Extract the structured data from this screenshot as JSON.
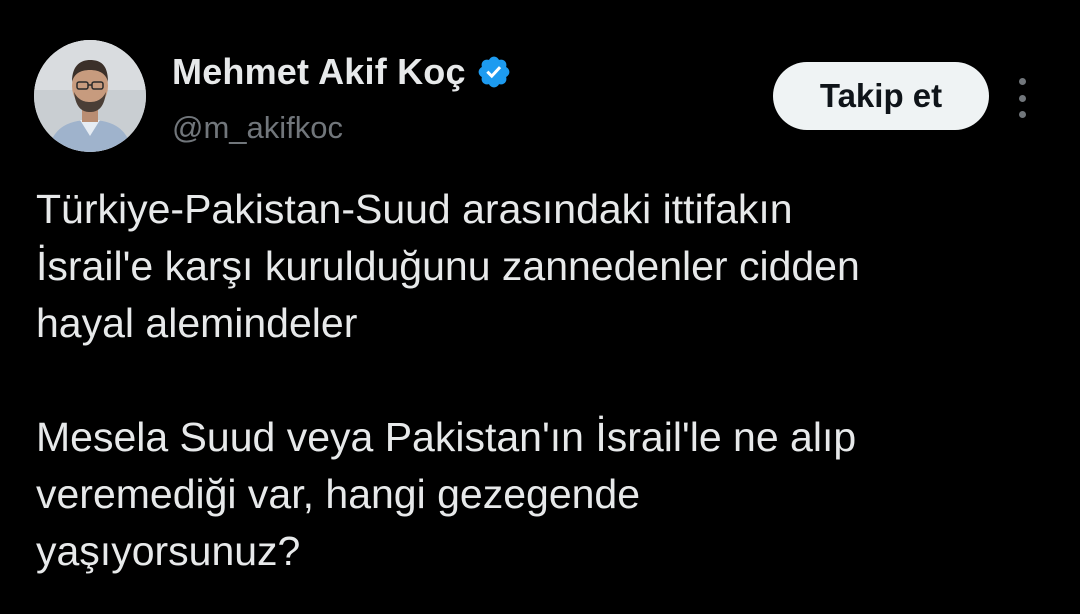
{
  "author": {
    "display_name": "Mehmet Akif Koç",
    "handle": "@m_akifkoc",
    "verified": true,
    "verified_color": "#1d9bf0",
    "avatar_icon": "profile-photo"
  },
  "actions": {
    "follow_label": "Takip et",
    "more_icon": "three-dots-vertical"
  },
  "tweet": {
    "paragraphs": [
      "Türkiye-Pakistan-Suud arasındaki ittifakın\nİsrail'e karşı kurulduğunu zannedenler cidden\nhayal alemindeler",
      "Mesela Suud veya Pakistan'ın İsrail'le ne alıp\nveremediği var, hangi gezegende\nyaşıyorsunuz?"
    ]
  },
  "colors": {
    "background": "#000000",
    "primary_text": "#e7e9ea",
    "secondary_text": "#71767b",
    "button_bg": "#eff3f4",
    "button_text": "#0f1419"
  }
}
